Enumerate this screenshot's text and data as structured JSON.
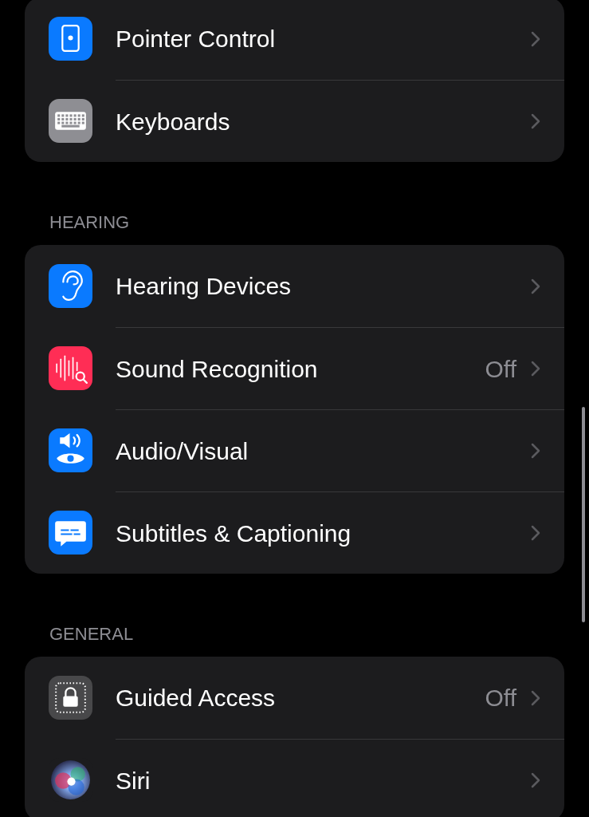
{
  "sections": [
    {
      "items": [
        {
          "kind": "pointer",
          "label": "Pointer Control"
        },
        {
          "kind": "keyboard",
          "label": "Keyboards"
        }
      ]
    },
    {
      "header": "HEARING",
      "items": [
        {
          "kind": "ear",
          "label": "Hearing Devices"
        },
        {
          "kind": "sound",
          "label": "Sound Recognition",
          "value": "Off"
        },
        {
          "kind": "audiovisual",
          "label": "Audio/Visual"
        },
        {
          "kind": "subtitles",
          "label": "Subtitles & Captioning"
        }
      ]
    },
    {
      "header": "GENERAL",
      "items": [
        {
          "kind": "lock",
          "label": "Guided Access",
          "value": "Off"
        },
        {
          "kind": "siri",
          "label": "Siri"
        }
      ]
    }
  ]
}
